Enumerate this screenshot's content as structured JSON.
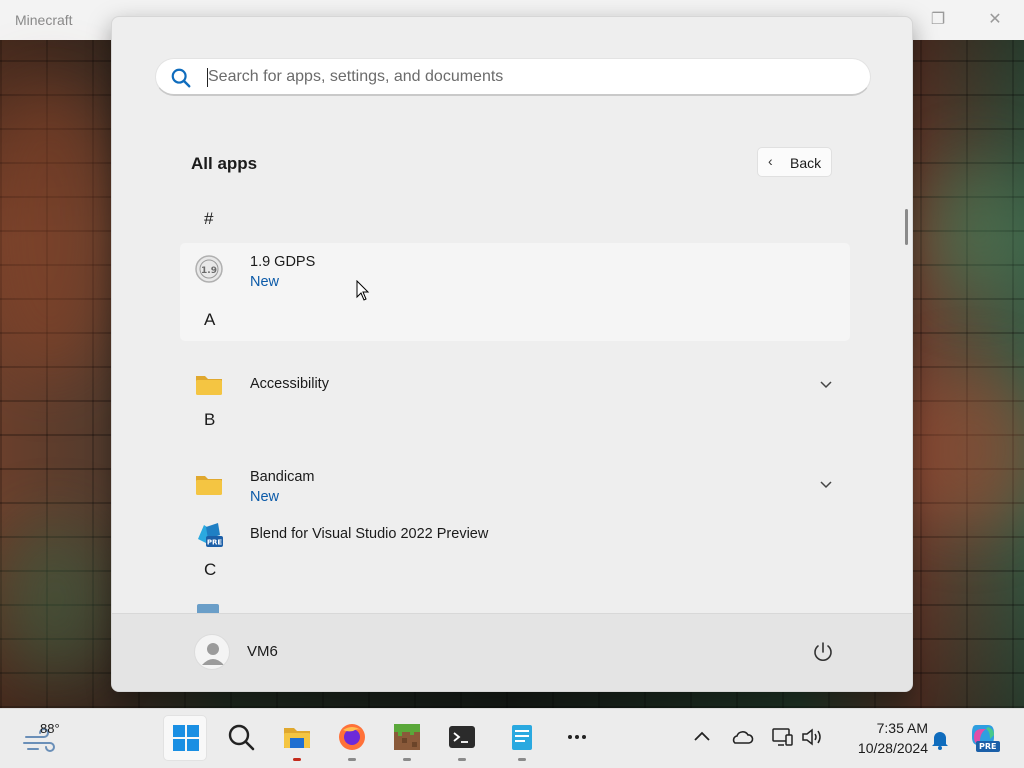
{
  "background_window": {
    "title": "Minecraft",
    "controls": [
      "restore-icon",
      "close-icon"
    ]
  },
  "start_menu": {
    "search": {
      "placeholder": "Search for apps, settings, and documents",
      "value": ""
    },
    "header": {
      "title": "All apps",
      "back_label": "Back"
    },
    "sections": [
      {
        "letter": "#",
        "apps": [
          {
            "name": "1.9 GDPS",
            "badge": "New",
            "icon": "gdps-icon"
          }
        ]
      },
      {
        "letter": "A",
        "apps": [
          {
            "name": "Accessibility",
            "icon": "folder-icon",
            "expandable": true
          }
        ]
      },
      {
        "letter": "B",
        "apps": [
          {
            "name": "Bandicam",
            "badge": "New",
            "icon": "folder-icon",
            "expandable": true
          },
          {
            "name": "Blend for Visual Studio 2022 Preview",
            "icon": "blend-vs-preview-icon"
          }
        ]
      },
      {
        "letter": "C",
        "apps": []
      }
    ],
    "footer": {
      "user_name": "VM6",
      "power_icon": "power-icon"
    }
  },
  "taskbar": {
    "weather_temp": "88°",
    "pinned": [
      "start-icon",
      "search-icon",
      "file-explorer-icon",
      "firefox-icon",
      "minecraft-icon",
      "terminal-icon",
      "notepad-icon",
      "more-icon"
    ],
    "tray": [
      "chevron-up-icon",
      "onedrive-icon",
      "network-icon",
      "volume-icon"
    ],
    "clock": {
      "time": "7:35 AM",
      "date": "10/28/2024"
    },
    "notification_icon": "bell-icon",
    "copilot_badge": "PRE",
    "accent_color": "#c42b1c"
  },
  "colors": {
    "badge_new": "#0b5aa8",
    "folder_yellow": "#f4c542",
    "search_accent": "#0f6cbd"
  }
}
